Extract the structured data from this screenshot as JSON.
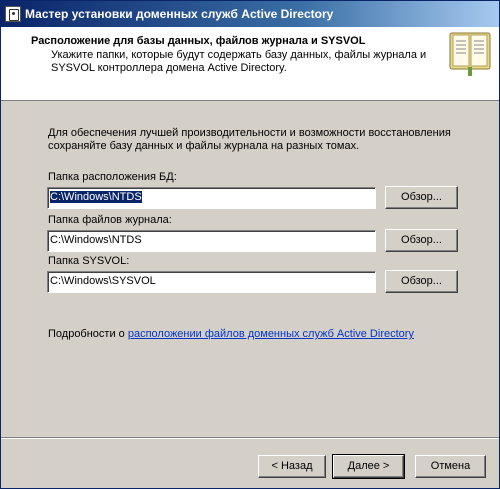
{
  "window": {
    "title": "Мастер установки доменных служб Active Directory"
  },
  "header": {
    "title": "Расположение для базы данных, файлов журнала и SYSVOL",
    "description": "Укажите папки, которые будут содержать базу данных, файлы журнала и SYSVOL контроллера домена Active Directory."
  },
  "main": {
    "intro": "Для обеспечения лучшей производительности и возможности восстановления сохраняйте базу данных и файлы журнала на разных томах.",
    "fields": [
      {
        "label": "Папка расположения БД:",
        "value": "C:\\Windows\\NTDS",
        "browse_label": "Обзор..."
      },
      {
        "label": "Папка файлов журнала:",
        "value": "C:\\Windows\\NTDS",
        "browse_label": "Обзор..."
      },
      {
        "label": "Папка SYSVOL:",
        "value": "C:\\Windows\\SYSVOL",
        "browse_label": "Обзор..."
      }
    ],
    "details_prefix": "Подробности о ",
    "details_link": "расположении файлов доменных служб Active Directory"
  },
  "footer": {
    "back_label": "< Назад",
    "next_label": "Далее >",
    "cancel_label": "Отмена"
  },
  "icons": {
    "window_icon": "setup-wizard-icon",
    "header_icon": "book-icon"
  }
}
